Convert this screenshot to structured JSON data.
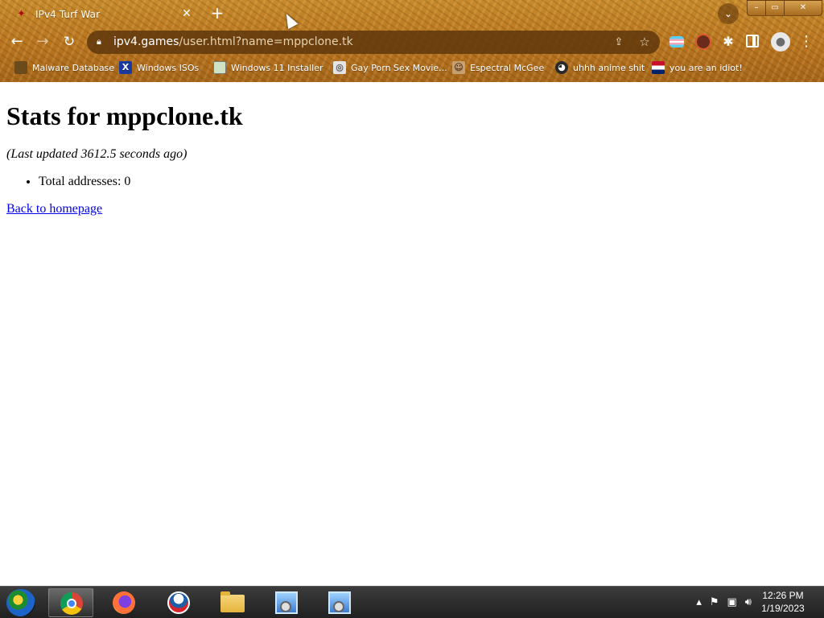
{
  "browser": {
    "tab_title": "IPv4 Turf War",
    "url_host": "ipv4.games",
    "url_rest": "/user.html?name=mppclone.tk",
    "bookmarks": [
      {
        "label": "Malware Database",
        "icon": "folder-icon"
      },
      {
        "label": "Windows ISOs",
        "icon": "x-icon"
      },
      {
        "label": "Windows 11 Installer",
        "icon": "image-icon"
      },
      {
        "label": "Gay Porn Sex Movie...",
        "icon": "globe-icon"
      },
      {
        "label": "Espectral McGee",
        "icon": "face-icon"
      },
      {
        "label": "uhhh anime shit",
        "icon": "anime-icon"
      },
      {
        "label": "you are an idiot!",
        "icon": "flag-icon"
      }
    ]
  },
  "page": {
    "heading": "Stats for mppclone.tk",
    "last_updated": "(Last updated 3612.5 seconds ago)",
    "total_addresses": "Total addresses: 0",
    "back_link": "Back to homepage"
  },
  "taskbar": {
    "time": "12:26 PM",
    "date": "1/19/2023"
  }
}
